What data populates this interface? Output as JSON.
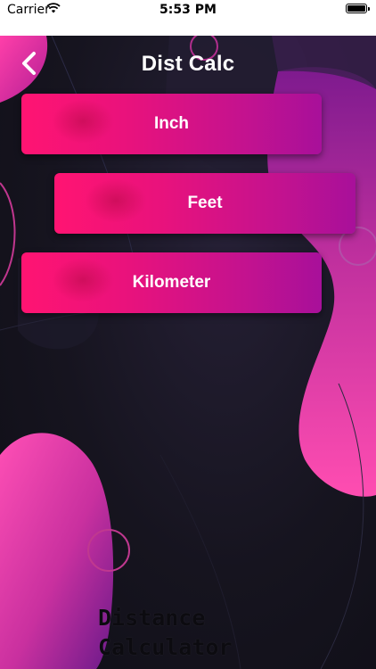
{
  "status_bar": {
    "carrier": "Carrier",
    "time": "5:53 PM"
  },
  "nav": {
    "title": "Dist Calc",
    "back_icon": "chevron-left-icon"
  },
  "buttons": {
    "inch": "Inch",
    "feet": "Feet",
    "kilometer": "Kilometer"
  },
  "logo": {
    "line1": "Distance",
    "line2": "Calculator"
  },
  "colors": {
    "button_start": "#ff1472",
    "button_end": "#a8109a",
    "background": "#16141f",
    "blob_pink": "#f43fa6",
    "blob_purple": "#8a1fa0"
  }
}
